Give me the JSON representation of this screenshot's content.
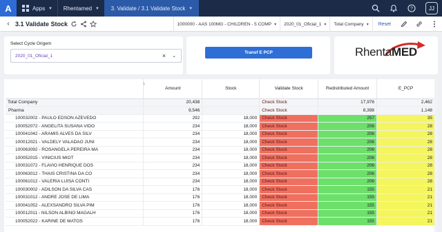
{
  "topbar": {
    "logo": "A",
    "crumbs": [
      "Apps",
      "Rhentamed",
      "3. Validate / 3.1 Validate Stock"
    ],
    "user_initials": "JJ"
  },
  "page": {
    "title": "3.1 Validate Stock",
    "filters": [
      "1000000 - AAS 100MG - CHILDREN - 5 COMP",
      "2020_01_Oficial_1",
      "Total Company"
    ],
    "reset_label": "Reset"
  },
  "cycle": {
    "label": "Select Cycle Origem",
    "value": "2020_01_Oficial_1"
  },
  "action": {
    "button_label": "Transf E PCP"
  },
  "brand": {
    "text_a": "Rhenta",
    "text_b": "MED"
  },
  "colors": {
    "accent": "#2f6ed4",
    "red_cell": "#f07060",
    "green_cell": "#6ce06a",
    "yellow_cell": "#f5f55e",
    "topbar": "#1b2b48"
  },
  "table": {
    "columns": [
      "",
      "Amount",
      "Stock",
      "Validate Stock",
      "Redistributed Amount",
      "E_PCP"
    ],
    "rows": [
      {
        "name": "Total Company",
        "amount": "20,438",
        "stock": "",
        "validate": "Check Stock",
        "redistributed": "17,976",
        "epcp": "2,462",
        "level": 0
      },
      {
        "name": "Pharma",
        "amount": "9,546",
        "stock": "",
        "validate": "Check Stock",
        "redistributed": "8,398",
        "epcp": "1,148",
        "level": 1
      },
      {
        "name": "100032002 - PAULO EDSON AZEVEDO",
        "amount": "292",
        "stock": "18,000",
        "validate": "Check Stock",
        "redistributed": "257",
        "epcp": "35",
        "level": 2
      },
      {
        "name": "100052072 - ANGELITA SUSANA VIDO",
        "amount": "234",
        "stock": "18,000",
        "validate": "Check Stock",
        "redistributed": "206",
        "epcp": "28",
        "level": 2
      },
      {
        "name": "100041042 - ARAMIS ALVES DA SILV",
        "amount": "234",
        "stock": "18,000",
        "validate": "Check Stock",
        "redistributed": "206",
        "epcp": "28",
        "level": 2
      },
      {
        "name": "100012021 - VALDELY VALADAO JUNI",
        "amount": "234",
        "stock": "18,000",
        "validate": "Check Stock",
        "redistributed": "206",
        "epcp": "28",
        "level": 2
      },
      {
        "name": "100063092 - ROSANGELA PEREIRA MA",
        "amount": "234",
        "stock": "18,000",
        "validate": "Check Stock",
        "redistributed": "206",
        "epcp": "28",
        "level": 2
      },
      {
        "name": "100052015 - VINICIUS MIOT",
        "amount": "234",
        "stock": "18,000",
        "validate": "Check Stock",
        "redistributed": "206",
        "epcp": "28",
        "level": 2
      },
      {
        "name": "100031072 - FLAVIO HENRIQUE DOS",
        "amount": "234",
        "stock": "18,000",
        "validate": "Check Stock",
        "redistributed": "206",
        "epcp": "28",
        "level": 2
      },
      {
        "name": "100063012 - THAIS CRISTINA DA CO",
        "amount": "234",
        "stock": "18,000",
        "validate": "Check Stock",
        "redistributed": "206",
        "epcp": "28",
        "level": 2
      },
      {
        "name": "100061012 - VALERIA LUISA CONTI",
        "amount": "234",
        "stock": "18,000",
        "validate": "Check Stock",
        "redistributed": "206",
        "epcp": "28",
        "level": 2
      },
      {
        "name": "100030002 - ADILSON DA SILVA CAS",
        "amount": "176",
        "stock": "18,000",
        "validate": "Check Stock",
        "redistributed": "155",
        "epcp": "21",
        "level": 2
      },
      {
        "name": "100031012 - ANDRE JOSE DE LIMA",
        "amount": "176",
        "stock": "18,000",
        "validate": "Check Stock",
        "redistributed": "155",
        "epcp": "21",
        "level": 2
      },
      {
        "name": "100041052 - ALEXSANDRO SILVA PIM",
        "amount": "176",
        "stock": "18,000",
        "validate": "Check Stock",
        "redistributed": "155",
        "epcp": "21",
        "level": 2
      },
      {
        "name": "100012011 - NILSON ALBINO MAGALH",
        "amount": "176",
        "stock": "18,000",
        "validate": "Check Stock",
        "redistributed": "155",
        "epcp": "21",
        "level": 2
      },
      {
        "name": "100052022 - KARINE DE MATOS",
        "amount": "176",
        "stock": "18,000",
        "validate": "Check Stock",
        "redistributed": "155",
        "epcp": "21",
        "level": 2
      }
    ]
  }
}
